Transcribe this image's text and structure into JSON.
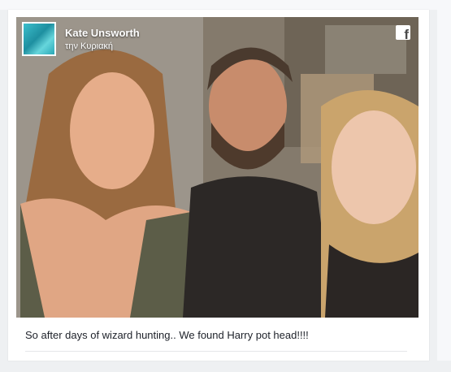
{
  "post": {
    "author": "Kate Unsworth",
    "timestamp": "την Κυριακή",
    "caption": "So after days of wizard hunting.. We found Harry pot head!!!!",
    "platform_icon": "facebook-icon"
  },
  "colors": {
    "card_background": "#ffffff",
    "page_background": "#eef0f2",
    "text": "#1d2129"
  }
}
